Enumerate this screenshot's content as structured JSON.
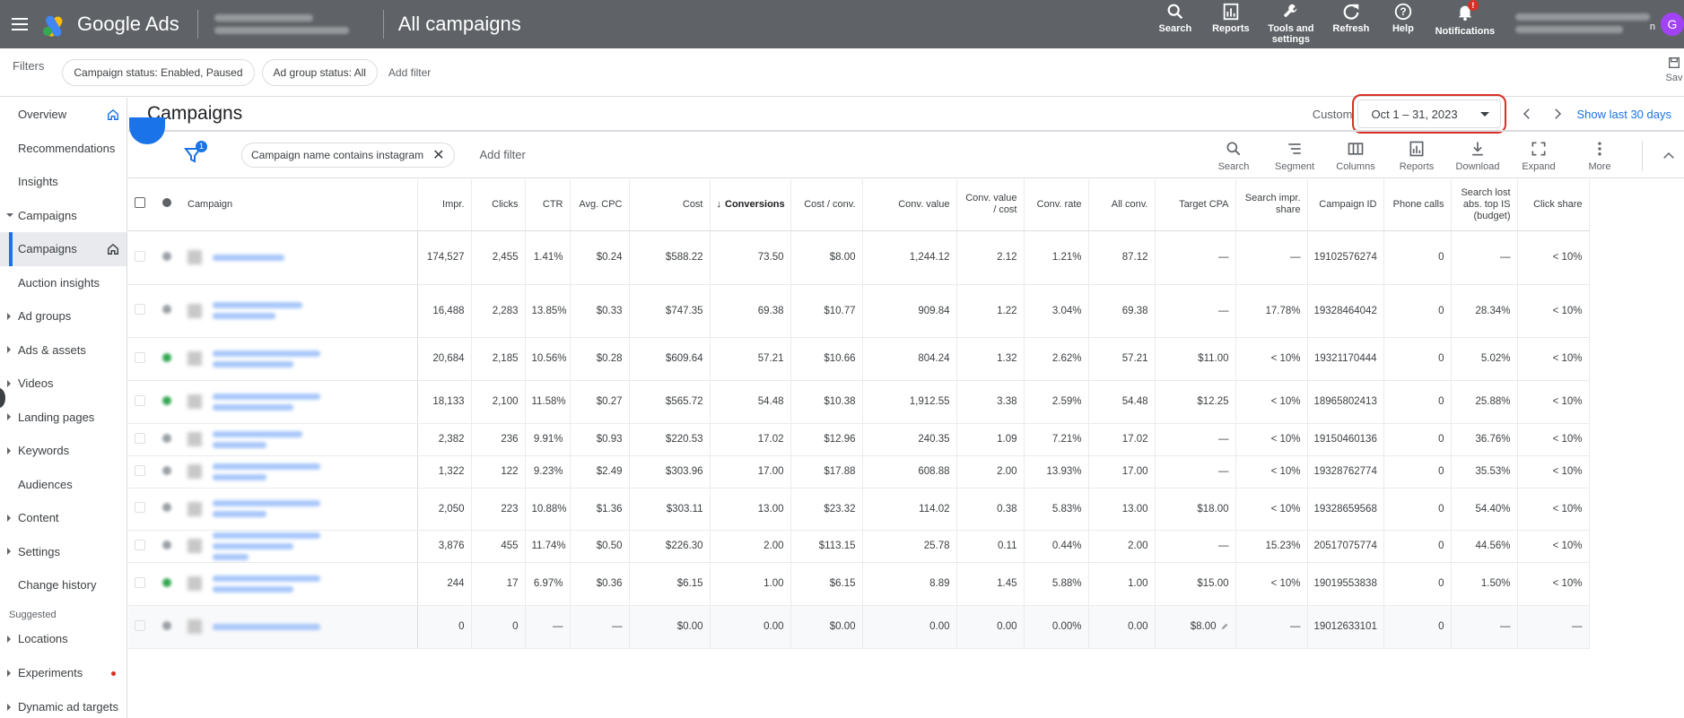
{
  "topbar": {
    "app_name": "Google Ads",
    "page_title": "All campaigns",
    "actions": [
      {
        "label": "Search",
        "icon": "search-icon"
      },
      {
        "label": "Reports",
        "icon": "reports-icon"
      },
      {
        "label": "Tools and settings",
        "icon": "tools-icon"
      },
      {
        "label": "Refresh",
        "icon": "refresh-icon"
      },
      {
        "label": "Help",
        "icon": "help-icon"
      },
      {
        "label": "Notifications",
        "icon": "bell-icon",
        "badge": "!"
      }
    ],
    "avatar_letter": "G",
    "account_suffix": "n"
  },
  "filters": {
    "label": "Filters",
    "chips": [
      "Campaign status: Enabled, Paused",
      "Ad group status: All"
    ],
    "add_filter": "Add filter",
    "save_label": "Sav"
  },
  "sidebar": {
    "items": [
      {
        "label": "Overview",
        "arrow": "none",
        "home": true
      },
      {
        "label": "Recommendations",
        "arrow": "none"
      },
      {
        "label": "Insights",
        "arrow": "none"
      },
      {
        "label": "Campaigns",
        "arrow": "down"
      },
      {
        "label": "Campaigns",
        "arrow": "none",
        "active": true,
        "home": true
      },
      {
        "label": "Auction insights",
        "arrow": "none"
      },
      {
        "label": "Ad groups",
        "arrow": "right"
      },
      {
        "label": "Ads & assets",
        "arrow": "right"
      },
      {
        "label": "Videos",
        "arrow": "right"
      },
      {
        "label": "Landing pages",
        "arrow": "right"
      },
      {
        "label": "Keywords",
        "arrow": "right"
      },
      {
        "label": "Audiences",
        "arrow": "none"
      },
      {
        "label": "Content",
        "arrow": "right"
      },
      {
        "label": "Settings",
        "arrow": "right"
      },
      {
        "label": "Change history",
        "arrow": "none"
      }
    ],
    "suggested_label": "Suggested",
    "suggested_items": [
      {
        "label": "Locations",
        "arrow": "right"
      },
      {
        "label": "Experiments",
        "arrow": "right",
        "dot": true
      },
      {
        "label": "Dynamic ad targets",
        "arrow": "right"
      }
    ]
  },
  "main": {
    "title": "Campaigns",
    "custom_label": "Custom",
    "date_range": "Oct 1 – 31, 2023",
    "show_last": "Show last 30 days",
    "filter_badge": "1",
    "filter_chip": "Campaign name contains instagram",
    "add_filter": "Add filter",
    "tools": [
      "Search",
      "Segment",
      "Columns",
      "Reports",
      "Download",
      "Expand",
      "More"
    ]
  },
  "table": {
    "columns": [
      "Campaign",
      "Impr.",
      "Clicks",
      "CTR",
      "Avg. CPC",
      "Cost",
      "Conversions",
      "Cost / conv.",
      "Conv. value",
      "Conv. value / cost",
      "Conv. rate",
      "All conv.",
      "Target CPA",
      "Search impr. share",
      "Campaign ID",
      "Phone calls",
      "Search lost abs. top IS (budget)",
      "Click share"
    ],
    "rows": [
      {
        "status": "gray",
        "cells": [
          "174,527",
          "2,455",
          "1.41%",
          "$0.24",
          "$588.22",
          "73.50",
          "$8.00",
          "1,244.12",
          "2.12",
          "1.21%",
          "87.12",
          "—",
          "—",
          "19102576274",
          "0",
          "—",
          "< 10%"
        ]
      },
      {
        "status": "gray",
        "cells": [
          "16,488",
          "2,283",
          "13.85%",
          "$0.33",
          "$747.35",
          "69.38",
          "$10.77",
          "909.84",
          "1.22",
          "3.04%",
          "69.38",
          "—",
          "17.78%",
          "19328464042",
          "0",
          "28.34%",
          "< 10%"
        ]
      },
      {
        "status": "green",
        "cells": [
          "20,684",
          "2,185",
          "10.56%",
          "$0.28",
          "$609.64",
          "57.21",
          "$10.66",
          "804.24",
          "1.32",
          "2.62%",
          "57.21",
          "$11.00",
          "< 10%",
          "19321170444",
          "0",
          "5.02%",
          "< 10%"
        ]
      },
      {
        "status": "green",
        "cells": [
          "18,133",
          "2,100",
          "11.58%",
          "$0.27",
          "$565.72",
          "54.48",
          "$10.38",
          "1,912.55",
          "3.38",
          "2.59%",
          "54.48",
          "$12.25",
          "< 10%",
          "18965802413",
          "0",
          "25.88%",
          "< 10%"
        ]
      },
      {
        "status": "gray",
        "cells": [
          "2,382",
          "236",
          "9.91%",
          "$0.93",
          "$220.53",
          "17.02",
          "$12.96",
          "240.35",
          "1.09",
          "7.21%",
          "17.02",
          "—",
          "< 10%",
          "19150460136",
          "0",
          "36.76%",
          "< 10%"
        ]
      },
      {
        "status": "gray",
        "cells": [
          "1,322",
          "122",
          "9.23%",
          "$2.49",
          "$303.96",
          "17.00",
          "$17.88",
          "608.88",
          "2.00",
          "13.93%",
          "17.00",
          "—",
          "< 10%",
          "19328762774",
          "0",
          "35.53%",
          "< 10%"
        ]
      },
      {
        "status": "gray",
        "cells": [
          "2,050",
          "223",
          "10.88%",
          "$1.36",
          "$303.11",
          "13.00",
          "$23.32",
          "114.02",
          "0.38",
          "5.83%",
          "13.00",
          "$18.00",
          "< 10%",
          "19328659568",
          "0",
          "54.40%",
          "< 10%"
        ]
      },
      {
        "status": "gray",
        "cells": [
          "3,876",
          "455",
          "11.74%",
          "$0.50",
          "$226.30",
          "2.00",
          "$113.15",
          "25.78",
          "0.11",
          "0.44%",
          "2.00",
          "—",
          "15.23%",
          "20517075774",
          "0",
          "44.56%",
          "< 10%"
        ]
      },
      {
        "status": "green",
        "cells": [
          "244",
          "17",
          "6.97%",
          "$0.36",
          "$6.15",
          "1.00",
          "$6.15",
          "8.89",
          "1.45",
          "5.88%",
          "1.00",
          "$15.00",
          "< 10%",
          "19019553838",
          "0",
          "1.50%",
          "< 10%"
        ]
      },
      {
        "status": "gray",
        "cells": [
          "0",
          "0",
          "—",
          "—",
          "$0.00",
          "0.00",
          "$0.00",
          "0.00",
          "0.00",
          "0.00%",
          "0.00",
          "$8.00",
          "—",
          "19012633101",
          "0",
          "—",
          "—"
        ]
      }
    ]
  },
  "colors": {
    "topbar": "#5f6368",
    "accent": "#1a73e8",
    "highlight": "#d93025",
    "status_green": "#34a853",
    "status_gray": "#9aa0a6"
  }
}
